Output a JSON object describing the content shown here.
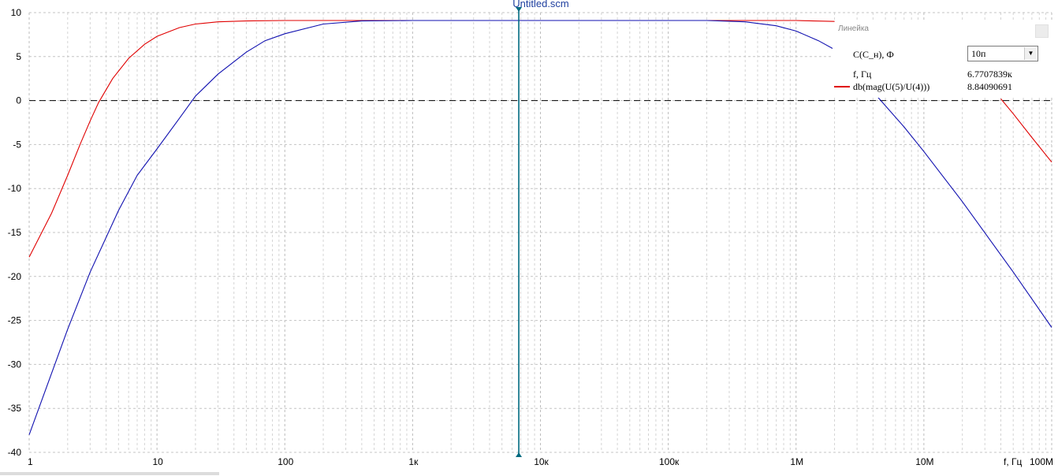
{
  "document_title": "Untitled.scm",
  "ruler_panel": {
    "title": "Линейка",
    "param_label": "C(C_н), Ф",
    "param_selected": "10п",
    "x_label": "f, Гц",
    "x_value": "6.7707839к",
    "series_label": "db(mag(U(5)/U(4)))",
    "series_value": "8.84090691"
  },
  "chart_data": {
    "type": "line",
    "xscale": "log",
    "xlim": [
      1,
      100000000
    ],
    "ylim": [
      -40,
      10
    ],
    "grid": true,
    "xlabel": "f, Гц",
    "x_ticks": [
      1,
      10,
      100,
      1000,
      10000,
      100000,
      1000000,
      10000000,
      100000000
    ],
    "x_tick_labels": [
      "1",
      "10",
      "100",
      "1к",
      "10к",
      "100к",
      "1М",
      "10М",
      "100М"
    ],
    "y_ticks": [
      10,
      5,
      0,
      -5,
      -10,
      -15,
      -20,
      -25,
      -30,
      -35,
      -40
    ],
    "y_tick_labels": [
      "10",
      "5",
      "0",
      "-5",
      "-10",
      "-15",
      "-20",
      "-25",
      "-30",
      "-35",
      "-40"
    ],
    "reference_line_y": 0,
    "cursor_x": 6770.7839,
    "colors": {
      "red_series": "#e00000",
      "blue_series": "#1010b0",
      "cursor": "#006a80"
    },
    "series": [
      {
        "color": "red",
        "points": [
          [
            1,
            -17.8
          ],
          [
            1.5,
            -12.8
          ],
          [
            2,
            -8.5
          ],
          [
            2.5,
            -5
          ],
          [
            3,
            -2.3
          ],
          [
            3.5,
            -0.2
          ],
          [
            4.5,
            2.5
          ],
          [
            6,
            4.8
          ],
          [
            8,
            6.4
          ],
          [
            10,
            7.3
          ],
          [
            15,
            8.3
          ],
          [
            20,
            8.7
          ],
          [
            30,
            8.95
          ],
          [
            50,
            9.05
          ],
          [
            100,
            9.1
          ],
          [
            1000000,
            9.1
          ],
          [
            2000000,
            9.0
          ]
        ]
      },
      {
        "color": "red",
        "points": [
          [
            40000000,
            0.2
          ],
          [
            50000000,
            -1.5
          ],
          [
            70000000,
            -4.2
          ],
          [
            100000000,
            -7.0
          ]
        ]
      },
      {
        "color": "blue",
        "points": [
          [
            1,
            -38
          ],
          [
            2,
            -26
          ],
          [
            3,
            -19.5
          ],
          [
            5,
            -12.5
          ],
          [
            7,
            -8.5
          ],
          [
            10,
            -5.5
          ],
          [
            15,
            -2
          ],
          [
            20,
            0.5
          ],
          [
            30,
            3
          ],
          [
            50,
            5.5
          ],
          [
            70,
            6.8
          ],
          [
            100,
            7.6
          ],
          [
            200,
            8.7
          ],
          [
            400,
            9.05
          ],
          [
            1000,
            9.1
          ],
          [
            200000,
            9.1
          ],
          [
            400000,
            8.95
          ],
          [
            700000,
            8.5
          ],
          [
            1000000,
            7.9
          ],
          [
            1500000,
            6.8
          ],
          [
            2000000,
            5.8
          ]
        ]
      },
      {
        "color": "blue",
        "points": [
          [
            4000000,
            1.0
          ],
          [
            7000000,
            -3.0
          ],
          [
            10000000,
            -5.8
          ],
          [
            20000000,
            -11.5
          ],
          [
            50000000,
            -19.5
          ],
          [
            100000000,
            -25.8
          ]
        ]
      }
    ]
  }
}
